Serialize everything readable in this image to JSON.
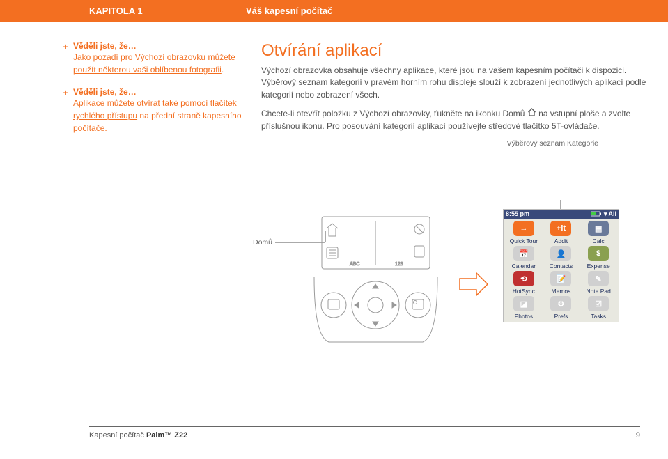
{
  "header": {
    "chapter": "KAPITOLA 1",
    "title": "Váš kapesní počítač"
  },
  "tips": [
    {
      "title": "Věděli jste, že…",
      "body_pre": "Jako pozadí pro Výchozí obrazovku ",
      "link1": "můžete použít některou vaši oblíbenou fotografii",
      "body_post": "."
    },
    {
      "title": "Věděli jste, že…",
      "body_pre": "Aplikace můžete otvírat také pomocí ",
      "link1": "tlačítek rychlého přístupu",
      "body_post": " na přední straně kapesního počítače."
    }
  ],
  "main": {
    "heading": "Otvírání aplikací",
    "p1": "Výchozí obrazovka obsahuje všechny aplikace, které jsou na vašem kapesním počítači k dispozici. Výběrový seznam kategorií v pravém horním rohu displeje slouží k zobrazení jednotlivých aplikací podle kategorií nebo zobrazení všech.",
    "p2a": "Chcete-li otevřít položku z Výchozí obrazovky, ťukněte na ikonku Domů ",
    "p2b": " na vstupní ploše a zvolte příslušnou ikonu. Pro posouvání kategorií aplikací používejte středové tlačítko 5T-ovládače.",
    "label_category": "Výběrový seznam Kategorie",
    "label_home": "Domů"
  },
  "palm": {
    "time": "8:55 pm",
    "category": "▾ All",
    "apps": [
      {
        "label": "Quick Tour",
        "color": "#F36F21",
        "glyph": "→"
      },
      {
        "label": "Addit",
        "color": "#F36F21",
        "glyph": "+it"
      },
      {
        "label": "Calc",
        "color": "#6a7a9a",
        "glyph": "▦"
      },
      {
        "label": "Calendar",
        "color": "#d0d0d0",
        "glyph": "📅"
      },
      {
        "label": "Contacts",
        "color": "#d0d0d0",
        "glyph": "👤"
      },
      {
        "label": "Expense",
        "color": "#8aa050",
        "glyph": "$"
      },
      {
        "label": "HotSync",
        "color": "#c03030",
        "glyph": "⟲"
      },
      {
        "label": "Memos",
        "color": "#d0d0d0",
        "glyph": "📝"
      },
      {
        "label": "Note Pad",
        "color": "#d0d0d0",
        "glyph": "✎"
      },
      {
        "label": "Photos",
        "color": "#d0d0d0",
        "glyph": "◪"
      },
      {
        "label": "Prefs",
        "color": "#d0d0d0",
        "glyph": "⚙"
      },
      {
        "label": "Tasks",
        "color": "#d0d0d0",
        "glyph": "☑"
      }
    ]
  },
  "footer": {
    "left_pre": "Kapesní počítač ",
    "left_bold": "Palm™ Z22",
    "page": "9"
  }
}
